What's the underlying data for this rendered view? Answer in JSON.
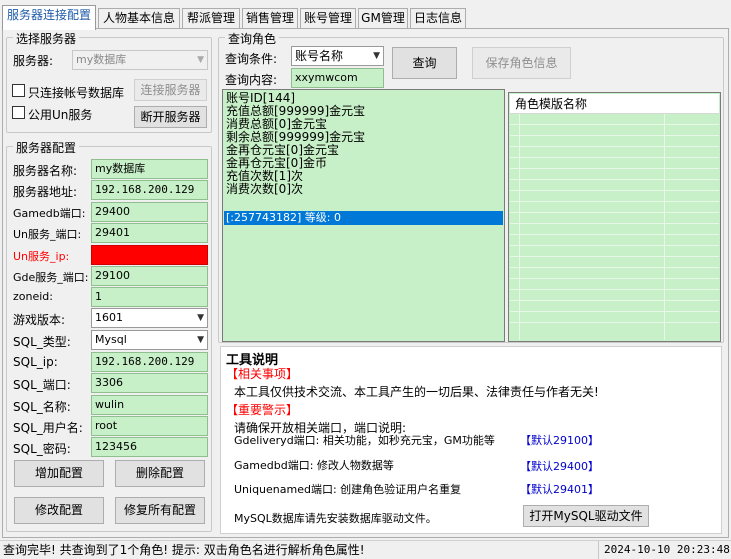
{
  "tabs": [
    "服务器连接配置",
    "人物基本信息",
    "帮派管理",
    "销售管理",
    "账号管理",
    "GM管理",
    "日志信息"
  ],
  "server_select": {
    "title": "选择服务器",
    "server_label": "服务器:",
    "server_value": "my数据库",
    "only_account_db_label": "只连接帐号数据库",
    "connect_button": "连接服务器",
    "public_un_label": "公用Un服务",
    "disconnect_button": "断开服务器"
  },
  "server_config": {
    "title": "服务器配置",
    "rows": [
      {
        "label": "服务器名称:",
        "value": "my数据库",
        "kind": "field"
      },
      {
        "label": "服务器地址:",
        "value": "192.168.200.129",
        "kind": "field"
      },
      {
        "label": "Gamedb端口:",
        "value": "29400",
        "kind": "field"
      },
      {
        "label": "Un服务_端口:",
        "value": "29401",
        "kind": "field"
      },
      {
        "label": "Un服务_ip:",
        "value": "",
        "kind": "redfield"
      },
      {
        "label": "Gde服务_端口:",
        "value": "29100",
        "kind": "field"
      },
      {
        "label": "zoneid:",
        "value": "1",
        "kind": "field"
      },
      {
        "label": "游戏版本:",
        "value": "1601",
        "kind": "select"
      },
      {
        "label": "SQL_类型:",
        "value": "Mysql",
        "kind": "select"
      },
      {
        "label": "SQL_ip:",
        "value": "192.168.200.129",
        "kind": "field"
      },
      {
        "label": "SQL_端口:",
        "value": "3306",
        "kind": "field"
      },
      {
        "label": "SQL_名称:",
        "value": "wulin",
        "kind": "field"
      },
      {
        "label": "SQL_用户名:",
        "value": "root",
        "kind": "field"
      },
      {
        "label": "SQL_密码:",
        "value": "123456",
        "kind": "field"
      }
    ],
    "add_button": "增加配置",
    "delete_button": "删除配置",
    "modify_button": "修改配置",
    "repair_button": "修复所有配置"
  },
  "query_role": {
    "title": "查询角色",
    "condition_label": "查询条件:",
    "condition_value": "账号名称",
    "content_label": "查询内容:",
    "content_value": "xxymwcom",
    "query_button": "查询",
    "save_button": "保存角色信息",
    "result_lines": [
      "账号ID[144]",
      "充值总额[999999]金元宝",
      "消费总额[0]金元宝",
      "剩余总额[999999]金元宝",
      "金再仓元宝[0]金元宝",
      "金再仓元宝[0]金币",
      "充值次数[1]次",
      "消费次数[0]次"
    ],
    "selected_row": "[:257743182] 等级: 0",
    "template_header": "角色模版名称"
  },
  "tool_info": {
    "title": "工具说明",
    "related_header": "【相关事项】",
    "related_text": "本工具仅供技术交流、本工具产生的一切后果、法律责任与作者无关!",
    "warning_header": "【重要警示】",
    "warning_intro": "请确保开放相关端口，端口说明:",
    "ports": [
      {
        "text": "Gdeliveryd端口: 相关功能，如秒充元宝，GM功能等",
        "default": "【默认29100】"
      },
      {
        "text": "Gamedbd端口: 修改人物数据等",
        "default": "【默认29400】"
      },
      {
        "text": "Uniquenamed端口: 创建角色验证用户名重复",
        "default": "【默认29401】"
      }
    ],
    "mysql_note": "MySQL数据库请先安装数据库驱动文件。",
    "mysql_button": "打开MySQL驱动文件"
  },
  "status": {
    "message": "查询完毕! 共查询到了1个角色! 提示: 双击角色名进行解析角色属性!",
    "datetime": "2024-10-10 20:23:48"
  }
}
